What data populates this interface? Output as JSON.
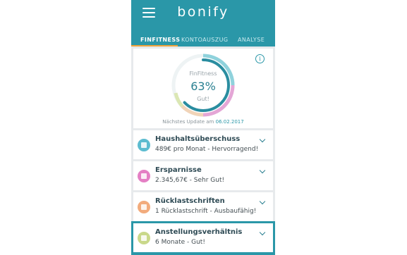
{
  "header": {
    "logo": "bonify",
    "menu_icon": "hamburger-menu-icon"
  },
  "tabs": [
    {
      "label": "FINFITNESS",
      "active": true
    },
    {
      "label": "KONTOAUSZUG",
      "active": false
    },
    {
      "label": "ANALYSE",
      "active": false
    }
  ],
  "gauge": {
    "title": "FinFitness",
    "percent": 63,
    "percent_label": "63%",
    "status": "Gut!",
    "update_prefix": "Nächstes Update am",
    "update_date": "06.02.2017"
  },
  "items": [
    {
      "title": "Haushaltsüberschuss",
      "subtitle": "489€ pro Monat - Hervorragend!",
      "icon": "calculator-icon",
      "color": "#5cbcd0"
    },
    {
      "title": "Ersparnisse",
      "subtitle": "2.345,67€ - Sehr Gut!",
      "icon": "piggy-bank-icon",
      "color": "#e47fc4"
    },
    {
      "title": "Rücklastschriften",
      "subtitle": "1 Rücklastschrift - Ausbaufähig!",
      "icon": "document-icon",
      "color": "#f2ab7c"
    },
    {
      "title": "Anstellungsverhältnis",
      "subtitle": "6 Monate - Gut!",
      "icon": "briefcase-icon",
      "color": "#c9d88a"
    }
  ],
  "colors": {
    "primary": "#2a97a8",
    "accent": "#f2a33a"
  }
}
